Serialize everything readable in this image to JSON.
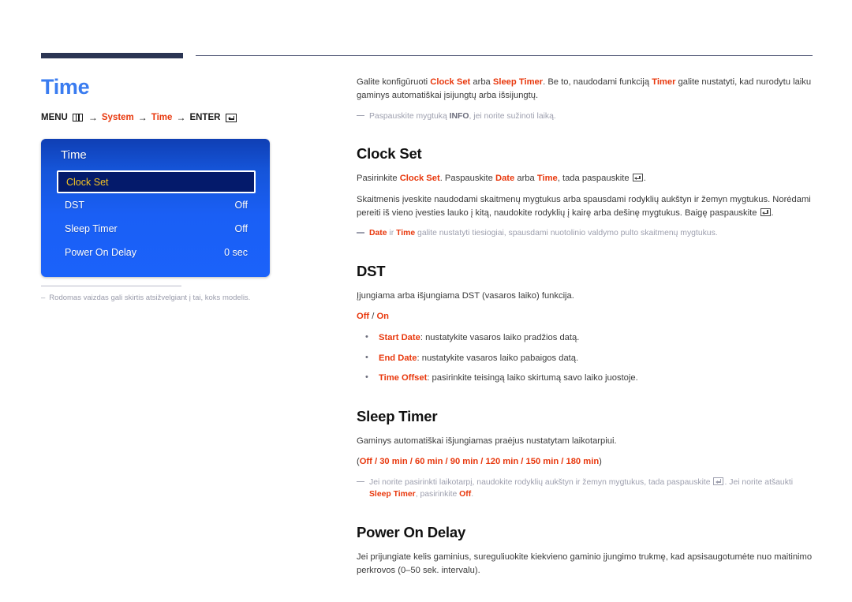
{
  "page": {
    "title": "Time",
    "menu_path": {
      "menu_label": "MENU",
      "menu_icon": "menu-grid-icon",
      "arrow": "→",
      "step1": "System",
      "step2": "Time",
      "enter_label": "ENTER",
      "enter_icon": "enter-return-icon"
    },
    "accent_blue": "#3a7cf0",
    "accent_red": "#e8380d",
    "rule_color": "#2b3553"
  },
  "osd": {
    "title": "Time",
    "rows": [
      {
        "label": "Clock Set",
        "value": "",
        "selected": true
      },
      {
        "label": "DST",
        "value": "Off",
        "selected": false
      },
      {
        "label": "Sleep Timer",
        "value": "Off",
        "selected": false
      },
      {
        "label": "Power On Delay",
        "value": "0 sec",
        "selected": false
      }
    ],
    "selected_text_color": "#f4c222",
    "background_gradient": [
      "#0f3fb4",
      "#1b62fa"
    ]
  },
  "left_footnote": {
    "dash": "–",
    "text": "Rodomas vaizdas gali skirtis atsižvelgiant į tai, koks modelis."
  },
  "intro": {
    "p1_a": "Galite konfigūruoti ",
    "p1_b": "Clock Set",
    "p1_c": " arba ",
    "p1_d": "Sleep Timer",
    "p1_e": ". Be to, naudodami funkciją ",
    "p1_f": "Timer",
    "p1_g": " galite nustatyti, kad nurodytu laiku gaminys automatiškai įsijungtų arba išsijungtų.",
    "note_a": "Paspauskite mygtuką ",
    "note_b": "INFO",
    "note_c": ", jei norite sužinoti laiką."
  },
  "clock_set": {
    "heading": "Clock Set",
    "p1_a": "Pasirinkite ",
    "p1_b": "Clock Set",
    "p1_c": ". Paspauskite ",
    "p1_d": "Date",
    "p1_e": " arba ",
    "p1_f": "Time",
    "p1_g": ", tada paspauskite ",
    "p1_h": ".",
    "p2": "Skaitmenis įveskite naudodami skaitmenų mygtukus arba spausdami rodyklių aukštyn ir žemyn mygtukus. Norėdami pereiti iš vieno įvesties lauko į kitą, naudokite rodyklių į kairę arba dešinę mygtukus. Baigę paspauskite ",
    "p2_end": ".",
    "note_a": "Date",
    "note_b": " ir ",
    "note_c": "Time",
    "note_d": " galite nustatyti tiesiogiai, spausdami nuotolinio valdymo pulto skaitmenų mygtukus."
  },
  "dst": {
    "heading": "DST",
    "p1": "Įjungiama arba išjungiama DST (vasaros laiko) funkcija.",
    "options_off": "Off",
    "options_sep": " / ",
    "options_on": "On",
    "bullets": [
      {
        "term": "Start Date",
        "desc": ": nustatykite vasaros laiko pradžios datą."
      },
      {
        "term": "End Date",
        "desc": ": nustatykite vasaros laiko pabaigos datą."
      },
      {
        "term": "Time Offset",
        "desc": ": pasirinkite teisingą laiko skirtumą savo laiko juostoje."
      }
    ]
  },
  "sleep_timer": {
    "heading": "Sleep Timer",
    "p1": "Gaminys automatiškai išjungiamas praėjus nustatytam laikotarpiui.",
    "options_open": "(",
    "options": "Off / 30 min / 60 min / 90 min / 120 min / 150 min / 180 min",
    "options_close": ")",
    "note_a": "Jei norite pasirinkti laikotarpį, naudokite rodyklių aukštyn ir žemyn mygtukus, tada paspauskite ",
    "note_b": ". Jei norite atšaukti ",
    "note_c": "Sleep Timer",
    "note_d": ", pasirinkite ",
    "note_e": "Off",
    "note_f": "."
  },
  "power_on_delay": {
    "heading": "Power On Delay",
    "p1": "Jei prijungiate kelis gaminius, sureguliuokite kiekvieno gaminio įjungimo trukmę, kad apsisaugotumėte nuo maitinimo perkrovos (0–50 sek. intervalu)."
  }
}
